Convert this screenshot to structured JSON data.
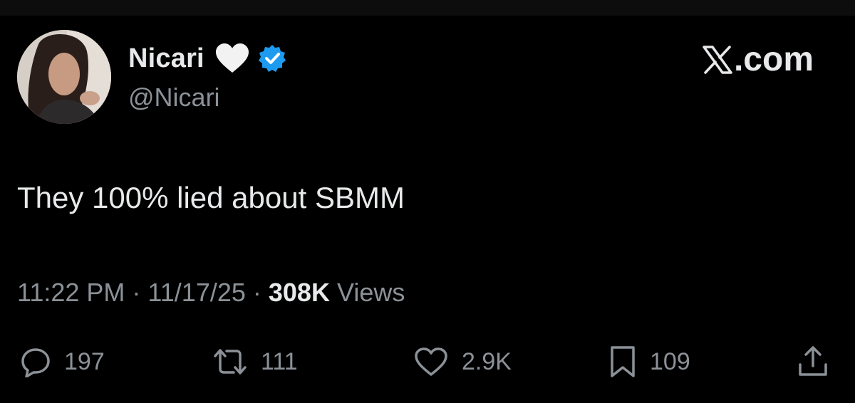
{
  "author": {
    "display_name": "Nicari",
    "handle": "@Nicari",
    "badges": [
      "white-heart-icon",
      "verified-badge-icon"
    ],
    "verified_color": "#1d9bf0"
  },
  "brand": {
    "symbol": "𝕏",
    "suffix": ".com"
  },
  "tweet": {
    "text": "They 100% lied about SBMM"
  },
  "meta": {
    "time": "11:22 PM",
    "separator": "·",
    "date": "11/17/25",
    "views_count": "308K",
    "views_label": "Views"
  },
  "actions": {
    "replies": "197",
    "retweets": "111",
    "likes": "2.9K",
    "bookmarks": "109",
    "share_icon": "share-icon"
  },
  "colors": {
    "background": "#000000",
    "primary_text": "#e7e9ea",
    "secondary_text": "#8b9197"
  }
}
